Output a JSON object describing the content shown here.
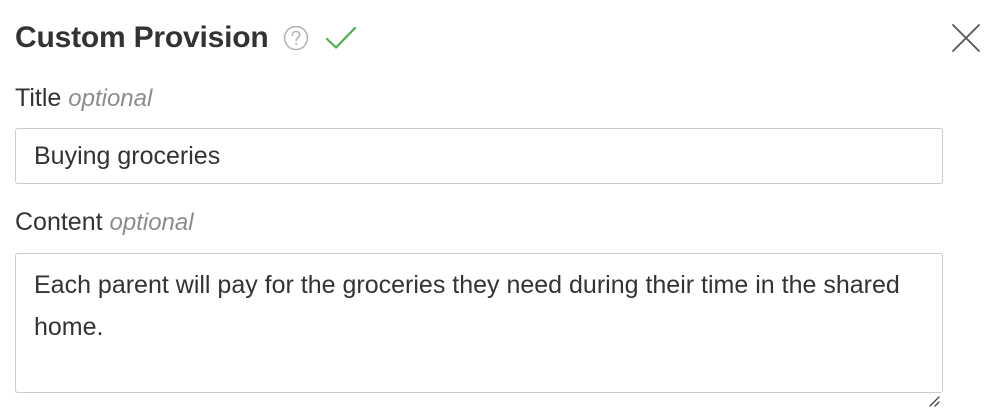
{
  "header": {
    "title": "Custom Provision",
    "help_icon": "question-circle-icon",
    "status_icon": "checkmark-icon",
    "close_icon": "close-x-icon"
  },
  "fields": {
    "title": {
      "label": "Title",
      "optional_hint": "optional",
      "value": "Buying groceries"
    },
    "content": {
      "label": "Content",
      "optional_hint": "optional",
      "value": "Each parent will pay for the groceries they need during their time in the shared home."
    }
  },
  "colors": {
    "text": "#333333",
    "muted": "#8c8c8c",
    "border": "#cccccc",
    "check_green": "#4caf50",
    "icon_gray": "#b3b3b3"
  }
}
